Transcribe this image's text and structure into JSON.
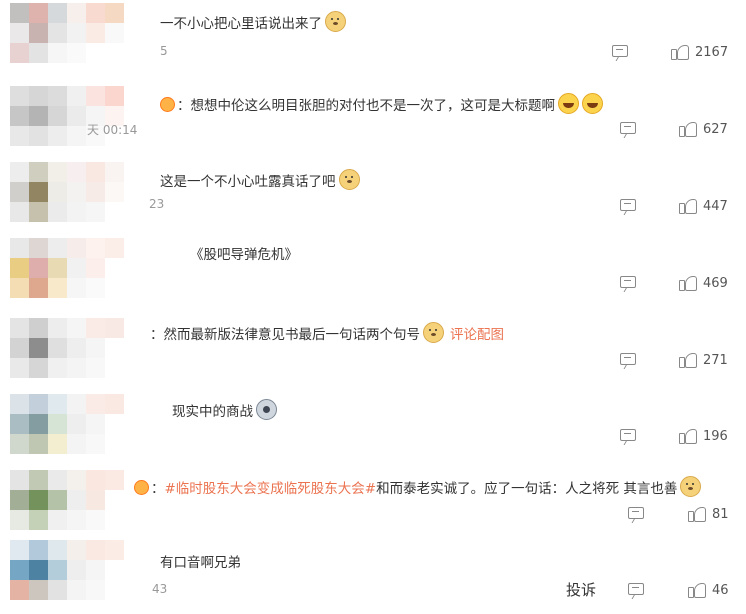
{
  "comments": [
    {
      "text": "一不小心把心里话说出来了",
      "emoji": "doge",
      "time": "5",
      "likes": "2167",
      "mosaic": [
        "#b8b4b5",
        "#d9a69f",
        "#cfd3d6",
        "#f6ede9",
        "#f9d4c8",
        "#f4d3b8",
        "#e7e5e5",
        "#bfa6a3",
        "#e0e0e0",
        "#f0f0f0",
        "#fae9e1",
        "#f9f9f9",
        "#e4c9c9",
        "#dfdfdf",
        "#f5f5f5",
        "#fafafa",
        "#ffffff",
        "#ffffff"
      ]
    },
    {
      "prefix_emoji": "fire",
      "text": "想想中伦这么明目张胆的对付也不是一次了，这可是大标题啊",
      "emoji": "laugh",
      "emoji2": "laugh",
      "time": "天 00:14",
      "likes": "627",
      "mosaic": [
        "#d9d9d9",
        "#cfcfcf",
        "#d6d6d6",
        "#eeeeee",
        "#fbe0da",
        "#fad0c6",
        "#bdbdbd",
        "#a8a8a8",
        "#d0d0d0",
        "#e8e8e8",
        "#f4f4f4",
        "#fdf2ee",
        "#e5e5e5",
        "#dedede",
        "#ebebeb",
        "#f4f4f4",
        "#f8f8f8",
        "#ffffff"
      ]
    },
    {
      "text": "这是一个不小心吐露真话了吧",
      "emoji": "doge",
      "time": "23",
      "likes": "447",
      "mosaic": [
        "#eaeaea",
        "#c8c6b3",
        "#f0ece5",
        "#f6eded",
        "#f8e3de",
        "#f9f3f0",
        "#c9c7c2",
        "#7e7146",
        "#ebe9e3",
        "#f1f0ef",
        "#f5e8e2",
        "#fbf7f5",
        "#e5e5e5",
        "#bcb79f",
        "#e8e8e8",
        "#f2f2f2",
        "#f5f5f5",
        "#ffffff"
      ]
    },
    {
      "text": "《股吧导弹危机》",
      "emoji": "",
      "time": "",
      "likes": "469",
      "mosaic": [
        "#e5e5e5",
        "#d9cfcc",
        "#ebebeb",
        "#f5ebe8",
        "#fdf0ec",
        "#fbeae5",
        "#e6c56d",
        "#d9a19e",
        "#e5d5a8",
        "#f0efef",
        "#fcede8",
        "#ffffff",
        "#f3d8a5",
        "#d99a7c",
        "#f6e6c0",
        "#f5f5f5",
        "#fafafa",
        "#ffffff"
      ]
    },
    {
      "text": "：然而最新版法律意见书最后一句话两个句号",
      "emoji": "doge",
      "link": "评论配图",
      "time": "",
      "likes": "271",
      "mosaic": [
        "#e0e0e0",
        "#c7c7c7",
        "#ebebeb",
        "#f4f4f4",
        "#fbe8e3",
        "#f8e6e1",
        "#cccccc",
        "#7a7a7a",
        "#dadada",
        "#ececec",
        "#f4f4f4",
        "#ffffff",
        "#e6e6e6",
        "#cfcfcf",
        "#eeeeee",
        "#f3f3f3",
        "#f7f7f7",
        "#ffffff"
      ]
    },
    {
      "text": "现实中的商战",
      "emoji": "husky",
      "time": "",
      "likes": "196",
      "mosaic": [
        "#d5dde5",
        "#b9c8d6",
        "#dbe6ea",
        "#f2f2f2",
        "#fae8e2",
        "#fae5de",
        "#9cb2b8",
        "#6f8c91",
        "#cfe0cf",
        "#ececec",
        "#f4f4f4",
        "#ffffff",
        "#c8d2c6",
        "#b4bea5",
        "#f3ecc8",
        "#f3f3f3",
        "#f7f7f7",
        "#ffffff"
      ]
    },
    {
      "prefix_emoji": "fire",
      "hashtag": "#临时股东大会变成临死股东大会#",
      "text": "和而泰老实诚了。应了一句话：人之将死 其言也善",
      "emoji": "doge",
      "time": "",
      "likes": "81",
      "mosaic": [
        "#e0e0e0",
        "#b7c0a9",
        "#e7e7e7",
        "#f3efe9",
        "#fae3da",
        "#fbe7e0",
        "#93a186",
        "#5c8040",
        "#a8b898",
        "#ececec",
        "#f6e5dd",
        "#ffffff",
        "#e3e7de",
        "#bcc9aa",
        "#eeeeee",
        "#f4f4f4",
        "#f8f8f8",
        "#ffffff"
      ]
    },
    {
      "text": "有口音啊兄弟",
      "emoji": "",
      "time": "43",
      "likes": "46",
      "report": "投诉",
      "mosaic": [
        "#dbe6ee",
        "#a5c0d6",
        "#d9e4ea",
        "#f4ede9",
        "#fae6de",
        "#fbe9e2",
        "#5e97b9",
        "#2f6d94",
        "#a6c5d4",
        "#ececec",
        "#f4f4f4",
        "#ffffff",
        "#e0a695",
        "#c4bdb4",
        "#dedede",
        "#f3f3f3",
        "#f7f7f7",
        "#ffffff"
      ]
    }
  ]
}
